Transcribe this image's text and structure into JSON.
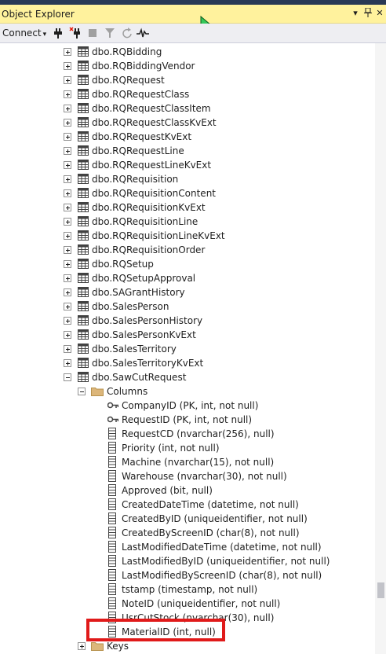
{
  "panel": {
    "title": "Object Explorer",
    "pin_glyph": "▾",
    "autohide_glyph": "ᛘ",
    "close_glyph": "✕"
  },
  "toolbar": {
    "connect_label": "Connect",
    "connect_arrow": "▾"
  },
  "tree": {
    "tables": [
      "dbo.RQBidding",
      "dbo.RQBiddingVendor",
      "dbo.RQRequest",
      "dbo.RQRequestClass",
      "dbo.RQRequestClassItem",
      "dbo.RQRequestClassKvExt",
      "dbo.RQRequestKvExt",
      "dbo.RQRequestLine",
      "dbo.RQRequestLineKvExt",
      "dbo.RQRequisition",
      "dbo.RQRequisitionContent",
      "dbo.RQRequisitionKvExt",
      "dbo.RQRequisitionLine",
      "dbo.RQRequisitionLineKvExt",
      "dbo.RQRequisitionOrder",
      "dbo.RQSetup",
      "dbo.RQSetupApproval",
      "dbo.SAGrantHistory",
      "dbo.SalesPerson",
      "dbo.SalesPersonHistory",
      "dbo.SalesPersonKvExt",
      "dbo.SalesTerritory",
      "dbo.SalesTerritoryKvExt"
    ],
    "expanded_table": "dbo.SawCutRequest",
    "columns_folder": "Columns",
    "columns": [
      {
        "text": "CompanyID (PK, int, not null)",
        "icon": "key-icon"
      },
      {
        "text": "RequestID (PK, int, not null)",
        "icon": "key-icon"
      },
      {
        "text": "RequestCD (nvarchar(256), null)",
        "icon": "column-icon"
      },
      {
        "text": "Priority (int, not null)",
        "icon": "column-icon"
      },
      {
        "text": "Machine (nvarchar(15), not null)",
        "icon": "column-icon"
      },
      {
        "text": "Warehouse (nvarchar(30), not null)",
        "icon": "column-icon"
      },
      {
        "text": "Approved (bit, null)",
        "icon": "column-icon"
      },
      {
        "text": "CreatedDateTime (datetime, not null)",
        "icon": "column-icon"
      },
      {
        "text": "CreatedByID (uniqueidentifier, not null)",
        "icon": "column-icon"
      },
      {
        "text": "CreatedByScreenID (char(8), not null)",
        "icon": "column-icon"
      },
      {
        "text": "LastModifiedDateTime (datetime, not null)",
        "icon": "column-icon"
      },
      {
        "text": "LastModifiedByID (uniqueidentifier, not null)",
        "icon": "column-icon"
      },
      {
        "text": "LastModifiedByScreenID (char(8), not null)",
        "icon": "column-icon"
      },
      {
        "text": "tstamp (timestamp, not null)",
        "icon": "column-icon"
      },
      {
        "text": "NoteID (uniqueidentifier, not null)",
        "icon": "column-icon"
      },
      {
        "text": "UsrCutStock (nvarchar(30), null)",
        "icon": "column-icon"
      },
      {
        "text": "MaterialID (int, null)",
        "icon": "column-icon",
        "highlighted": true
      }
    ],
    "keys_folder": "Keys"
  },
  "colors": {
    "title_bar": "#fff29d",
    "top_strip": "#293955",
    "highlight_box": "#e01a1a",
    "toolbar": "#eeeef2"
  }
}
